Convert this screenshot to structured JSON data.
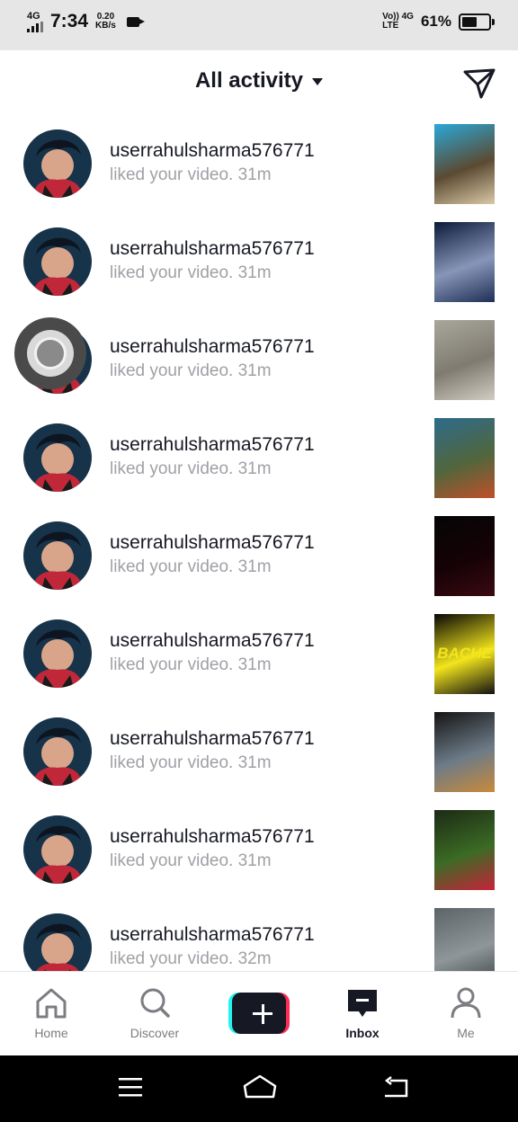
{
  "status_bar": {
    "network_left": "4G",
    "time": "7:34",
    "speed_value": "0.20",
    "speed_unit": "KB/s",
    "volte": "Vo)) 4G",
    "volte_sub": "LTE",
    "battery_percent": "61%",
    "battery_level": 0.61
  },
  "header": {
    "title": "All activity",
    "filter_icon": "caret-down-icon",
    "send_icon": "paper-plane-icon"
  },
  "notifications": [
    {
      "username": "userrahulsharma576771",
      "action": "liked your video.",
      "time": "31m",
      "thumb_colors": [
        "#2aa8d8",
        "#5b4a32",
        "#d9c9a5"
      ]
    },
    {
      "username": "userrahulsharma576771",
      "action": "liked your video.",
      "time": "31m",
      "thumb_colors": [
        "#0c1a3a",
        "#8796b8",
        "#1f2e55"
      ]
    },
    {
      "username": "userrahulsharma576771",
      "action": "liked your video.",
      "time": "31m",
      "thumb_colors": [
        "#a9a79c",
        "#7f7b70",
        "#d1cdc2"
      ]
    },
    {
      "username": "userrahulsharma576771",
      "action": "liked your video.",
      "time": "31m",
      "thumb_colors": [
        "#2d6b8c",
        "#51663c",
        "#c0502a"
      ]
    },
    {
      "username": "userrahulsharma576771",
      "action": "liked your video.",
      "time": "31m",
      "thumb_colors": [
        "#050505",
        "#150206",
        "#3a0a10"
      ]
    },
    {
      "username": "userrahulsharma576771",
      "action": "liked your video.",
      "time": "31m",
      "thumb_colors": [
        "#060606",
        "#f3e51c",
        "#111111"
      ],
      "thumb_text": "BACHE"
    },
    {
      "username": "userrahulsharma576771",
      "action": "liked your video.",
      "time": "31m",
      "thumb_colors": [
        "#141414",
        "#6d7b88",
        "#c88a3a"
      ]
    },
    {
      "username": "userrahulsharma576771",
      "action": "liked your video.",
      "time": "31m",
      "thumb_colors": [
        "#1c2a16",
        "#3b6b24",
        "#c8223a"
      ]
    },
    {
      "username": "userrahulsharma576771",
      "action": "liked your video.",
      "time": "32m",
      "thumb_colors": [
        "#5d6468",
        "#8e969a",
        "#3a3f42"
      ]
    }
  ],
  "bottom_nav": [
    {
      "label": "Home",
      "icon": "home-icon",
      "active": false
    },
    {
      "label": "Discover",
      "icon": "search-icon",
      "active": false
    },
    {
      "label": "",
      "icon": "plus-icon",
      "active": false
    },
    {
      "label": "Inbox",
      "icon": "inbox-icon",
      "active": true
    },
    {
      "label": "Me",
      "icon": "person-icon",
      "active": false
    }
  ],
  "system_nav": {
    "menu_icon": "menu-icon",
    "home_icon": "home-outline-icon",
    "back_icon": "back-icon"
  },
  "colors": {
    "text_primary": "#161823",
    "text_secondary": "#a0a0a6",
    "accent_cyan": "#25f4ee",
    "accent_red": "#fe2c55"
  }
}
